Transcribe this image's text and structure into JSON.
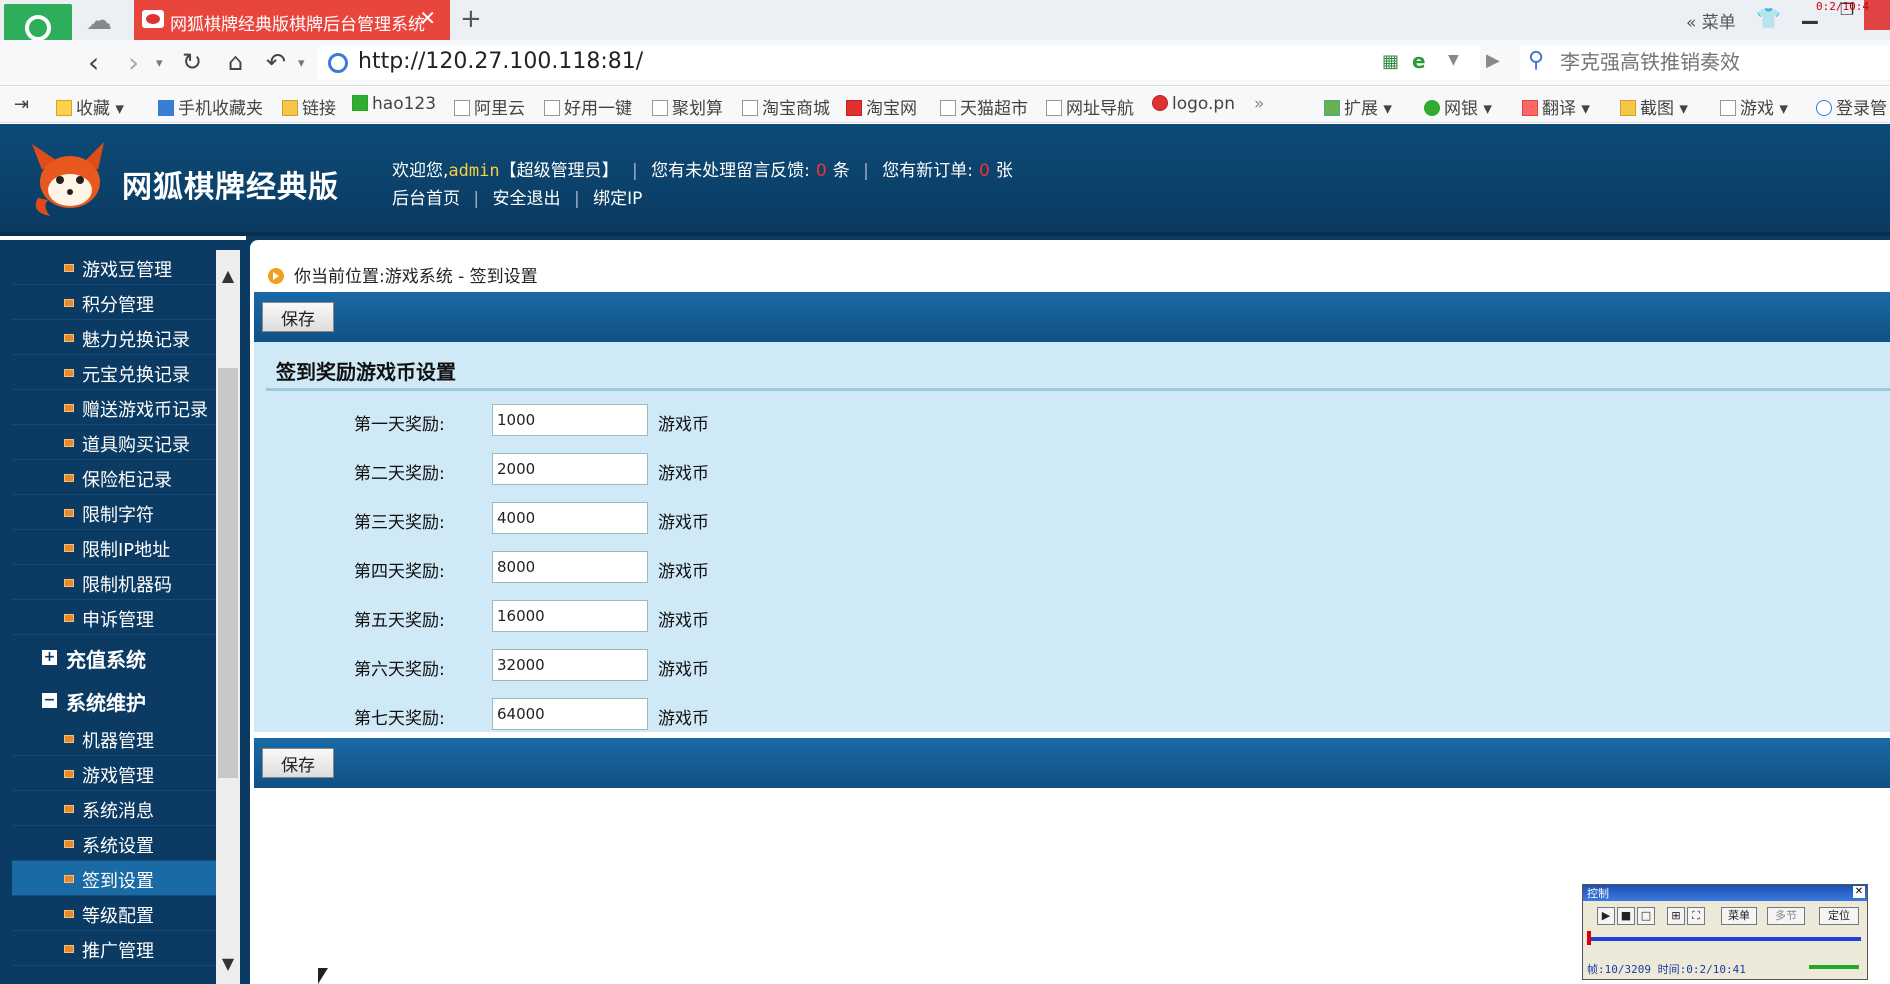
{
  "browser": {
    "tab_title": "网狐棋牌经典版棋牌后台管理系统",
    "new_tab": "+",
    "window_menu": "« 菜单",
    "corner_time": "0:2/10:4",
    "url": "http://120.27.100.118:81/",
    "search_placeholder": "李克强高铁推销奏效",
    "bookmarks": [
      "收藏",
      "手机收藏夹",
      "链接",
      "hao123",
      "阿里云",
      "好用一键",
      "聚划算",
      "淘宝商城",
      "淘宝网",
      "天猫超市",
      "网址导航",
      "logo.pn",
      "»",
      "扩展",
      "网银",
      "翻译",
      "截图",
      "游戏",
      "登录管"
    ]
  },
  "header": {
    "logo_text": "网狐棋牌经典版",
    "welcome": "欢迎您,",
    "username": "admin",
    "role": "【超级管理员】",
    "feedback_prefix": "您有未处理留言反馈:",
    "feedback_count": "0",
    "feedback_unit": "条",
    "orders_prefix": "您有新订单:",
    "orders_count": "0",
    "orders_unit": "张",
    "links": [
      "后台首页",
      "安全退出",
      "绑定IP"
    ]
  },
  "sidebar": {
    "items_top": [
      "游戏豆管理",
      "积分管理",
      "魅力兑换记录",
      "元宝兑换记录",
      "赠送游戏币记录",
      "道具购买记录",
      "保险柜记录",
      "限制字符",
      "限制IP地址",
      "限制机器码",
      "申诉管理"
    ],
    "group_recharge": "充值系统",
    "group_recharge_toggle": "+",
    "group_maintenance": "系统维护",
    "group_maintenance_toggle": "−",
    "items_maintenance": [
      "机器管理",
      "游戏管理",
      "系统消息",
      "系统设置",
      "签到设置",
      "等级配置",
      "推广管理"
    ],
    "active_item": "签到设置"
  },
  "main": {
    "breadcrumb": "你当前位置:游戏系统 - 签到设置",
    "save_label": "保存",
    "section_title": "签到奖励游戏币设置",
    "unit": "游戏币",
    "rows": [
      {
        "label": "第一天奖励:",
        "value": "1000"
      },
      {
        "label": "第二天奖励:",
        "value": "2000"
      },
      {
        "label": "第三天奖励:",
        "value": "4000"
      },
      {
        "label": "第四天奖励:",
        "value": "8000"
      },
      {
        "label": "第五天奖励:",
        "value": "16000"
      },
      {
        "label": "第六天奖励:",
        "value": "32000"
      },
      {
        "label": "第七天奖励:",
        "value": "64000"
      }
    ]
  },
  "control_widget": {
    "title": "控制",
    "buttons": [
      "菜单",
      "多节",
      "定位"
    ],
    "status": "帧:10/3209 时间:0:2/10:41"
  }
}
